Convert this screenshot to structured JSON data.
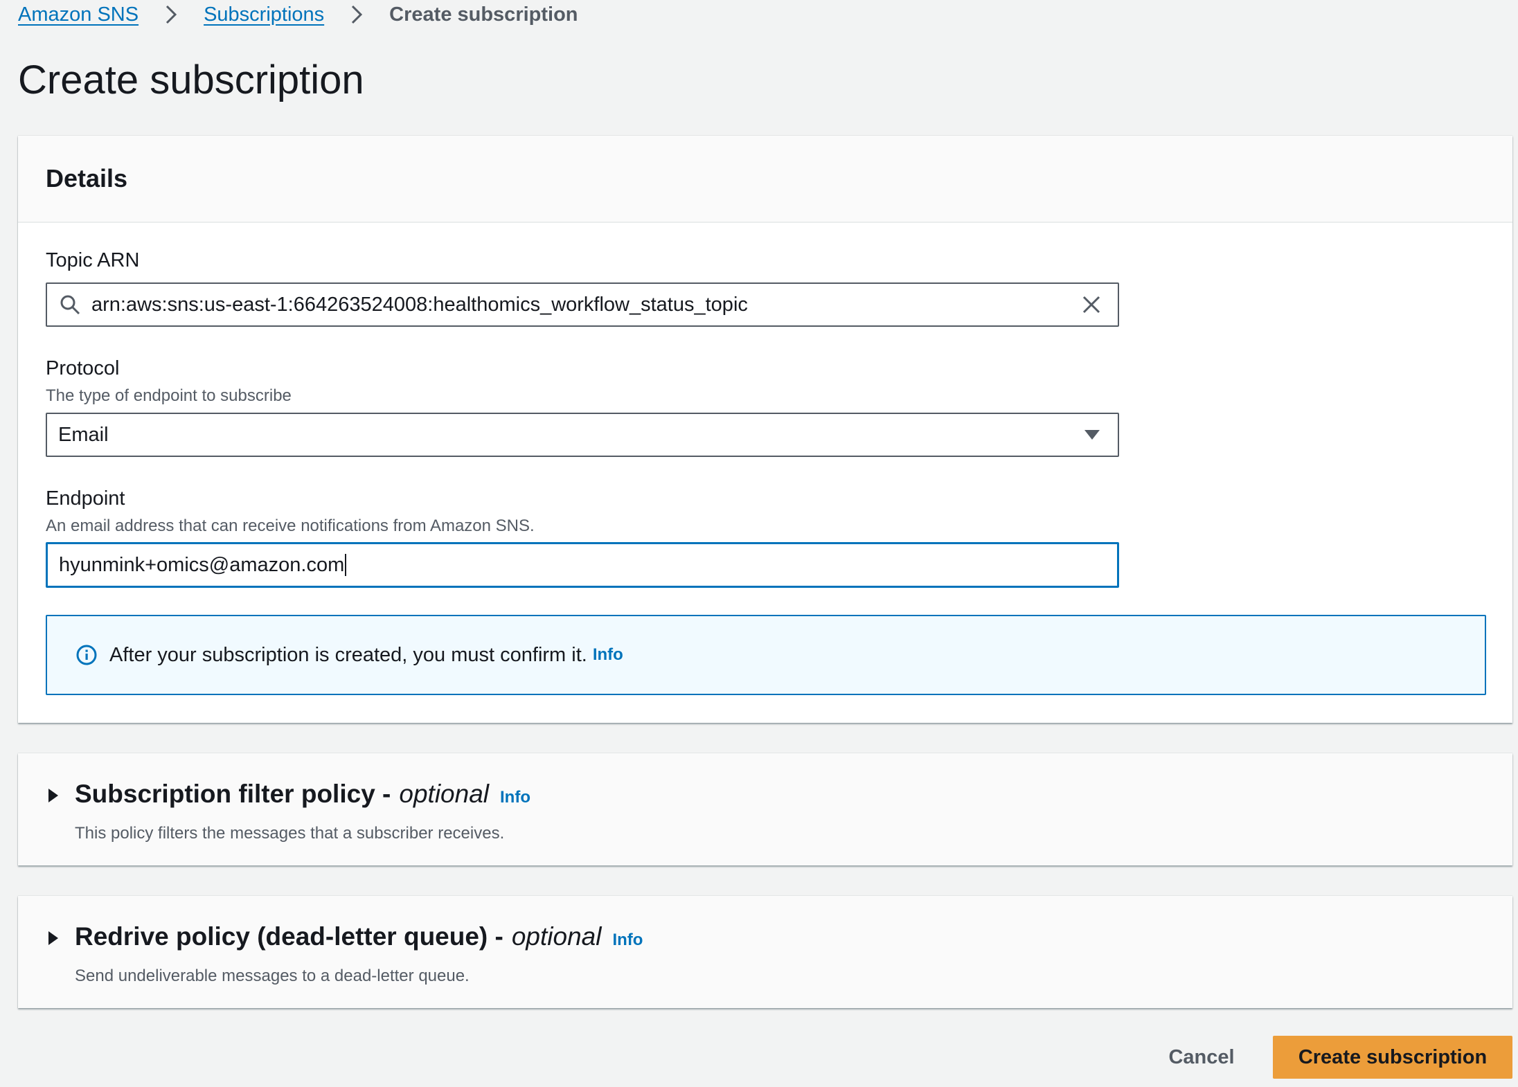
{
  "breadcrumb": {
    "items": [
      "Amazon SNS",
      "Subscriptions"
    ],
    "current": "Create subscription"
  },
  "page": {
    "title": "Create subscription"
  },
  "details": {
    "header": "Details",
    "topic_arn": {
      "label": "Topic ARN",
      "value": "arn:aws:sns:us-east-1:664263524008:healthomics_workflow_status_topic",
      "icon": "search-icon",
      "clear_icon": "close-icon"
    },
    "protocol": {
      "label": "Protocol",
      "description": "The type of endpoint to subscribe",
      "selected": "Email"
    },
    "endpoint": {
      "label": "Endpoint",
      "description": "An email address that can receive notifications from Amazon SNS.",
      "value": "hyunmink+omics@amazon.com"
    },
    "alert": {
      "text": "After your subscription is created, you must confirm it.",
      "link": "Info"
    }
  },
  "filter_policy": {
    "title": "Subscription filter policy -",
    "optional": "optional",
    "info": "Info",
    "description": "This policy filters the messages that a subscriber receives."
  },
  "redrive_policy": {
    "title": "Redrive policy (dead-letter queue) -",
    "optional": "optional",
    "info": "Info",
    "description": "Send undeliverable messages to a dead-letter queue."
  },
  "footer": {
    "cancel": "Cancel",
    "submit": "Create subscription"
  },
  "colors": {
    "link": "#0073bb",
    "primary_button": "#ec9d3a",
    "background": "#f2f3f3",
    "alert_background": "#f1faff"
  }
}
